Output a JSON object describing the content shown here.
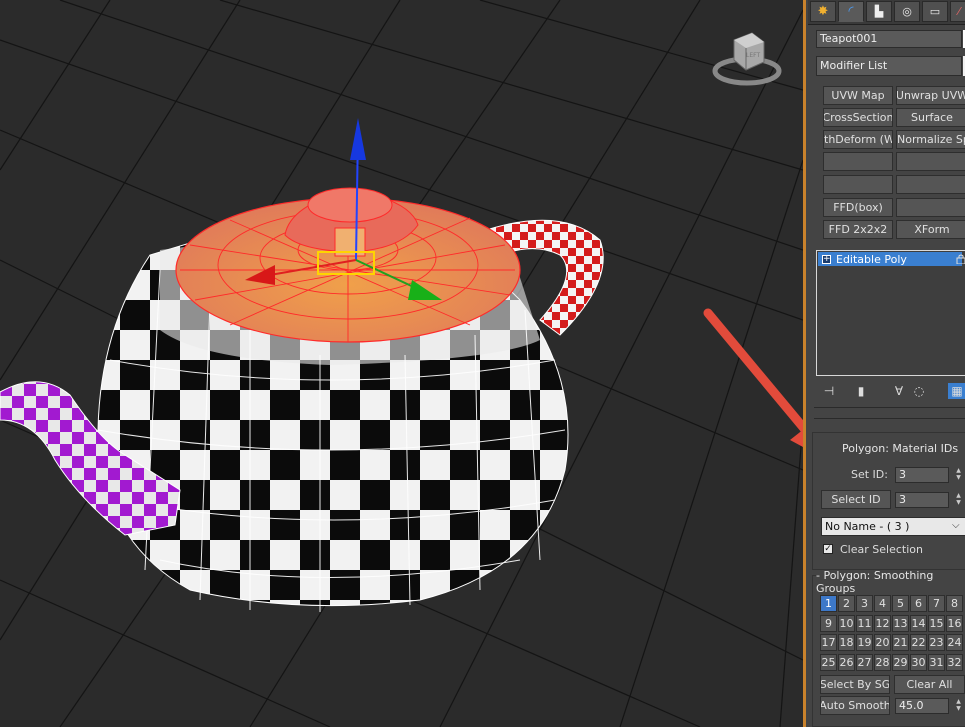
{
  "panel": {
    "object_name": "Teapot001",
    "modifier_list": "Modifier List",
    "modifier_buttons": [
      "UVW Map",
      "Unwrap UVW",
      "CrossSection",
      "Surface",
      "thDeform (WSI",
      "Normalize Spl.",
      "",
      "",
      "",
      "",
      "FFD(box)",
      "",
      "FFD 2x2x2",
      "XForm"
    ],
    "stack_item": "Editable Poly",
    "material_ids": {
      "title": "Polygon: Material IDs",
      "set_id_label": "Set ID:",
      "set_id_value": "3",
      "select_id_label": "Select ID",
      "select_id_value": "3",
      "name_dropdown": "No Name - ( 3 )",
      "clear_selection": "Clear Selection"
    },
    "smoothing": {
      "title": "- Polygon: Smoothing Groups",
      "groups": [
        "1",
        "2",
        "3",
        "4",
        "5",
        "6",
        "7",
        "8",
        "9",
        "10",
        "11",
        "12",
        "13",
        "14",
        "15",
        "16",
        "17",
        "18",
        "19",
        "20",
        "21",
        "22",
        "23",
        "24",
        "25",
        "26",
        "27",
        "28",
        "29",
        "30",
        "31",
        "32"
      ],
      "active_group": "1",
      "select_by_sg": "Select By SG",
      "clear_all": "Clear All",
      "auto_smooth": "Auto Smooth",
      "auto_smooth_value": "45.0"
    }
  },
  "tabs": [
    "create-tab",
    "modify-tab",
    "hierarchy-tab",
    "motion-tab",
    "display-tab",
    "utilities-tab"
  ],
  "viewcube_label": "LEFT",
  "colors": {
    "accent": "#c9822c",
    "selection": "#3a7fd0",
    "arrow": "#e24b3b"
  }
}
